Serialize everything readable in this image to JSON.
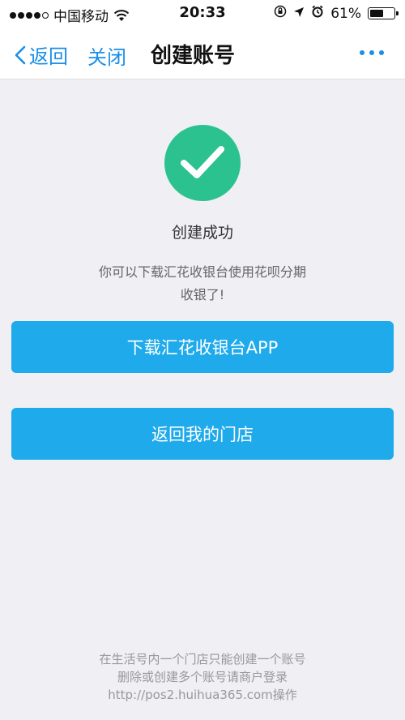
{
  "status_bar": {
    "carrier": "中国移动",
    "time": "20:33",
    "battery": "61%",
    "battery_level": 0.61,
    "signal_icon": "signal-dots-icon",
    "wifi_icon": "wifi-icon",
    "lock_icon": "rotation-lock-icon",
    "location_icon": "location-arrow-icon",
    "alarm_icon": "alarm-clock-icon"
  },
  "nav": {
    "back_label": "返回",
    "close_label": "关闭",
    "title": "创建账号",
    "more_icon": "more-dots-icon"
  },
  "success": {
    "icon": "check-icon",
    "icon_color": "#2cc28f",
    "title": "创建成功",
    "desc_line1": "你可以下载汇花收银台使用花呗分期",
    "desc_line2": "收银了!"
  },
  "buttons": {
    "download_label": "下载汇花收银台APP",
    "return_label": "返回我的门店",
    "color": "#1faaeb"
  },
  "footer": {
    "line1": "在生活号内一个门店只能创建一个账号",
    "line2": "删除或创建多个账号请商户登录",
    "line3": "http://pos2.huihua365.com操作"
  },
  "colors": {
    "accent": "#1a8ee8",
    "background": "#efeff4"
  }
}
